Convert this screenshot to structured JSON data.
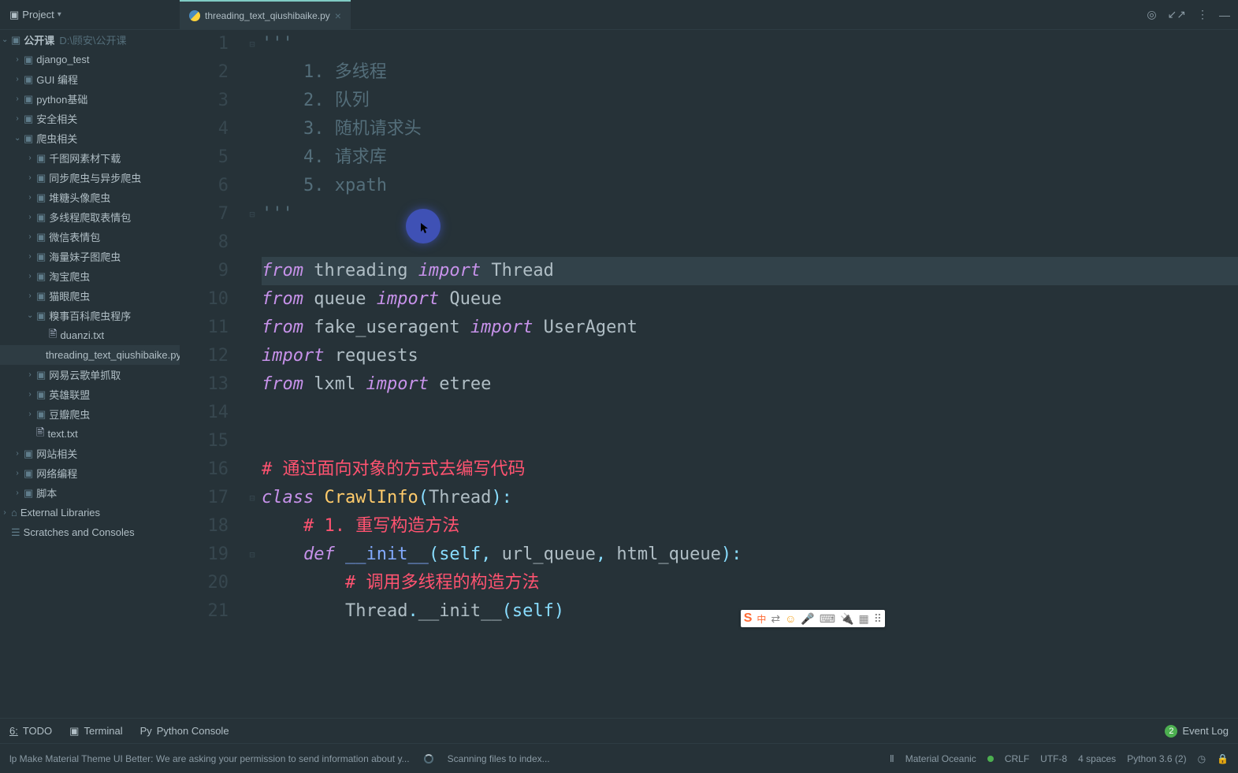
{
  "titleBar": {
    "projectLabel": "Project"
  },
  "tab": {
    "name": "threading_text_qiushibaike.py"
  },
  "sidebar": {
    "root": {
      "name": "公开课",
      "path": "D:\\顾安\\公开课"
    },
    "items": [
      {
        "depth": 1,
        "chev": "›",
        "icon": "folder",
        "label": "django_test"
      },
      {
        "depth": 1,
        "chev": "›",
        "icon": "folder",
        "label": "GUI 编程"
      },
      {
        "depth": 1,
        "chev": "›",
        "icon": "folder",
        "label": "python基础"
      },
      {
        "depth": 1,
        "chev": "›",
        "icon": "folder",
        "label": "安全相关"
      },
      {
        "depth": 1,
        "chev": "⌄",
        "icon": "folder",
        "label": "爬虫相关",
        "open": true
      },
      {
        "depth": 2,
        "chev": "›",
        "icon": "folder",
        "label": "千图网素材下载"
      },
      {
        "depth": 2,
        "chev": "›",
        "icon": "folder",
        "label": "同步爬虫与异步爬虫"
      },
      {
        "depth": 2,
        "chev": "›",
        "icon": "folder",
        "label": "堆糖头像爬虫"
      },
      {
        "depth": 2,
        "chev": "›",
        "icon": "folder",
        "label": "多线程爬取表情包"
      },
      {
        "depth": 2,
        "chev": "›",
        "icon": "folder",
        "label": "微信表情包"
      },
      {
        "depth": 2,
        "chev": "›",
        "icon": "folder",
        "label": "海量妹子图爬虫"
      },
      {
        "depth": 2,
        "chev": "›",
        "icon": "folder",
        "label": "淘宝爬虫"
      },
      {
        "depth": 2,
        "chev": "›",
        "icon": "folder",
        "label": "猫眼爬虫"
      },
      {
        "depth": 2,
        "chev": "⌄",
        "icon": "folder",
        "label": "糗事百科爬虫程序",
        "open": true
      },
      {
        "depth": 3,
        "chev": "",
        "icon": "file",
        "label": "duanzi.txt"
      },
      {
        "depth": 3,
        "chev": "",
        "icon": "pyfile",
        "label": "threading_text_qiushibaike.py",
        "selected": true
      },
      {
        "depth": 2,
        "chev": "›",
        "icon": "folder",
        "label": "网易云歌单抓取"
      },
      {
        "depth": 2,
        "chev": "›",
        "icon": "folder",
        "label": "英雄联盟"
      },
      {
        "depth": 2,
        "chev": "›",
        "icon": "folder",
        "label": "豆瓣爬虫"
      },
      {
        "depth": 2,
        "chev": "",
        "icon": "file",
        "label": "text.txt"
      },
      {
        "depth": 1,
        "chev": "›",
        "icon": "folder",
        "label": "网站相关"
      },
      {
        "depth": 1,
        "chev": "›",
        "icon": "folder",
        "label": "网络编程"
      },
      {
        "depth": 1,
        "chev": "›",
        "icon": "folder",
        "label": "脚本"
      }
    ],
    "externalLibs": "External Libraries",
    "scratches": "Scratches and Consoles"
  },
  "code": {
    "lines": [
      {
        "n": 1,
        "fold": "⊟",
        "segs": [
          {
            "cls": "c-str",
            "t": "'''"
          }
        ]
      },
      {
        "n": 2,
        "fold": "",
        "segs": [
          {
            "cls": "c-str",
            "t": "    1. 多线程"
          }
        ]
      },
      {
        "n": 3,
        "fold": "",
        "segs": [
          {
            "cls": "c-str",
            "t": "    2. 队列"
          }
        ]
      },
      {
        "n": 4,
        "fold": "",
        "segs": [
          {
            "cls": "c-str",
            "t": "    3. 随机请求头"
          }
        ]
      },
      {
        "n": 5,
        "fold": "",
        "segs": [
          {
            "cls": "c-str",
            "t": "    4. 请求库"
          }
        ]
      },
      {
        "n": 6,
        "fold": "",
        "segs": [
          {
            "cls": "c-str",
            "t": "    5. xpath"
          }
        ]
      },
      {
        "n": 7,
        "fold": "⊟",
        "segs": [
          {
            "cls": "c-str",
            "t": "'''"
          }
        ]
      },
      {
        "n": 8,
        "fold": "",
        "segs": []
      },
      {
        "n": 9,
        "fold": "",
        "hl": true,
        "segs": [
          {
            "cls": "c-kw",
            "t": "from"
          },
          {
            "cls": "c-name",
            "t": " threading "
          },
          {
            "cls": "c-kw",
            "t": "import"
          },
          {
            "cls": "c-name",
            "t": " Thread"
          }
        ]
      },
      {
        "n": 10,
        "fold": "",
        "segs": [
          {
            "cls": "c-kw",
            "t": "from"
          },
          {
            "cls": "c-name",
            "t": " queue "
          },
          {
            "cls": "c-kw",
            "t": "import"
          },
          {
            "cls": "c-name",
            "t": " Queue"
          }
        ]
      },
      {
        "n": 11,
        "fold": "",
        "segs": [
          {
            "cls": "c-kw",
            "t": "from"
          },
          {
            "cls": "c-name",
            "t": " fake_useragent "
          },
          {
            "cls": "c-kw",
            "t": "import"
          },
          {
            "cls": "c-name",
            "t": " UserAgent"
          }
        ]
      },
      {
        "n": 12,
        "fold": "",
        "segs": [
          {
            "cls": "c-kw",
            "t": "import"
          },
          {
            "cls": "c-name",
            "t": " requests"
          }
        ]
      },
      {
        "n": 13,
        "fold": "",
        "segs": [
          {
            "cls": "c-kw",
            "t": "from"
          },
          {
            "cls": "c-name",
            "t": " lxml "
          },
          {
            "cls": "c-kw",
            "t": "import"
          },
          {
            "cls": "c-name",
            "t": " etree"
          }
        ]
      },
      {
        "n": 14,
        "fold": "",
        "segs": []
      },
      {
        "n": 15,
        "fold": "",
        "segs": []
      },
      {
        "n": 16,
        "fold": "",
        "segs": [
          {
            "cls": "c-comment",
            "t": "# 通过面向对象的方式去编写代码"
          }
        ]
      },
      {
        "n": 17,
        "fold": "⊟",
        "segs": [
          {
            "cls": "c-def",
            "t": "class "
          },
          {
            "cls": "c-class",
            "t": "CrawlInfo"
          },
          {
            "cls": "c-op",
            "t": "("
          },
          {
            "cls": "c-name",
            "t": "Thread"
          },
          {
            "cls": "c-op",
            "t": "):"
          }
        ]
      },
      {
        "n": 18,
        "fold": "",
        "segs": [
          {
            "cls": "",
            "t": "    "
          },
          {
            "cls": "c-comment",
            "t": "# 1. 重写构造方法"
          }
        ]
      },
      {
        "n": 19,
        "fold": "⊟",
        "segs": [
          {
            "cls": "",
            "t": "    "
          },
          {
            "cls": "c-def",
            "t": "def "
          },
          {
            "cls": "c-fn",
            "t": "__init__"
          },
          {
            "cls": "c-op",
            "t": "("
          },
          {
            "cls": "c-builtin",
            "t": "self"
          },
          {
            "cls": "c-op",
            "t": ", "
          },
          {
            "cls": "c-name",
            "t": "url_queue"
          },
          {
            "cls": "c-op",
            "t": ", "
          },
          {
            "cls": "c-name",
            "t": "html_queue"
          },
          {
            "cls": "c-op",
            "t": "):"
          }
        ]
      },
      {
        "n": 20,
        "fold": "",
        "segs": [
          {
            "cls": "",
            "t": "        "
          },
          {
            "cls": "c-comment",
            "t": "# 调用多线程的构造方法"
          }
        ]
      },
      {
        "n": 21,
        "fold": "",
        "segs": [
          {
            "cls": "",
            "t": "        "
          },
          {
            "cls": "c-name",
            "t": "Thread"
          },
          {
            "cls": "c-op",
            "t": "."
          },
          {
            "cls": "c-name",
            "t": "__init__"
          },
          {
            "cls": "c-op",
            "t": "("
          },
          {
            "cls": "c-builtin",
            "t": "self"
          },
          {
            "cls": "c-op",
            "t": ")"
          }
        ]
      }
    ]
  },
  "bottomTools": {
    "todo": {
      "num": "6:",
      "label": "TODO"
    },
    "terminal": "Terminal",
    "pyconsole": "Python Console",
    "eventLog": "Event Log",
    "eventCount": "2"
  },
  "status": {
    "left1": "lp Make Material Theme UI Better: We are asking your permission to send information about y...",
    "scanning": "Scanning files to index...",
    "theme": "Material Oceanic",
    "crlf": "CRLF",
    "enc": "UTF-8",
    "indent": "4 spaces",
    "python": "Python 3.6 (2)"
  },
  "ime": {
    "s": "S",
    "cn": "中",
    "arrows": "⇄",
    "emoji": "☺",
    "mic": "🎤",
    "kb": "⌨",
    "usb": "🔌",
    "grid": "▦",
    "apps": "⠿"
  }
}
